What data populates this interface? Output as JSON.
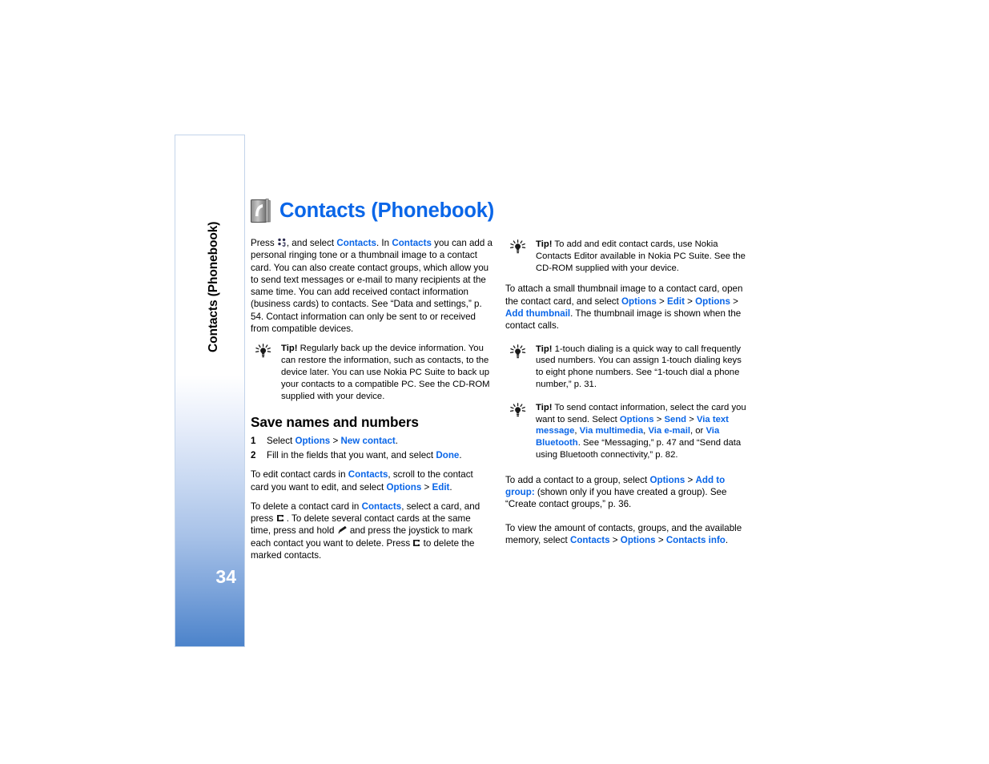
{
  "sidebar": {
    "tab_label": "Contacts (Phonebook)",
    "page_number": "34",
    "accent": "#4a82ca"
  },
  "header": {
    "icon": "phonebook-icon",
    "title": "Contacts (Phonebook)",
    "title_color": "#0a66e8"
  },
  "left_column": {
    "intro": {
      "t1": "Press ",
      "glyph1": "menu-key-icon",
      "t2": ", and select ",
      "l1": "Contacts",
      "t3": ". In ",
      "l2": "Contacts",
      "t4": " you can add a personal ringing tone or a thumbnail image to a contact card. You can also create contact groups, which allow you to send text messages or e-mail to many recipients at the same time. You can add received contact information (business cards) to contacts. See “Data and settings,” p. 54. Contact information can only be sent to or received from compatible devices."
    },
    "tip1": {
      "label": "Tip!",
      "text": " Regularly back up the device information. You can restore the information, such as contacts, to the device later. You can use Nokia PC Suite to back up your contacts to a compatible PC. See the CD-ROM supplied with your device."
    },
    "section_heading": "Save names and numbers",
    "step1": {
      "num": "1",
      "t1": "Select ",
      "l1": "Options",
      "t2": " > ",
      "l2": "New contact",
      "t3": "."
    },
    "step2": {
      "num": "2",
      "t1": "Fill in the fields that you want, and select ",
      "l1": "Done",
      "t2": "."
    },
    "edit_para": {
      "t1": "To edit contact cards in ",
      "l1": "Contacts",
      "t2": ", scroll to the contact card you want to edit, and select ",
      "l2": "Options",
      "t3": " > ",
      "l3": "Edit",
      "t4": "."
    },
    "delete_para": {
      "t1": "To delete a contact card in ",
      "l1": "Contacts",
      "t2": ", select a card, and press ",
      "glyph1": "clear-key-icon",
      "t3": " . To delete several contact cards at the same time, press and hold ",
      "glyph2": "edit-key-icon",
      "t4": " and press the joystick to mark each contact you want to delete. Press ",
      "glyph3": "clear-key-icon",
      "t5": " to delete the marked contacts."
    }
  },
  "right_column": {
    "tip2": {
      "label": "Tip!",
      "text": " To add and edit contact cards, use Nokia Contacts Editor available in Nokia PC Suite. See the CD-ROM supplied with your device."
    },
    "thumbnail_para": {
      "t1": "To attach a small thumbnail image to a contact card, open the contact card, and select ",
      "l1": "Options",
      "t2": " > ",
      "l2": "Edit",
      "t3": " > ",
      "l3": "Options",
      "t4": " > ",
      "l4": "Add thumbnail",
      "t5": ". The thumbnail image is shown when the contact calls."
    },
    "tip3": {
      "label": "Tip!",
      "text": " 1-touch dialing is a quick way to call frequently used numbers. You can assign 1-touch dialing keys to eight phone numbers. See “1-touch dial a phone number,” p. 31."
    },
    "tip4": {
      "label": "Tip!",
      "t1": " To send contact information, select the card you want to send. Select ",
      "l1": "Options",
      "t2": " > ",
      "l2": "Send",
      "t3": " > ",
      "l3": "Via text message",
      "t4": ", ",
      "l4": "Via multimedia",
      "t5": ", ",
      "l5": "Via e-mail",
      "t6": ", or ",
      "l6": "Via Bluetooth",
      "t7": ". See “Messaging,” p. 47 and “Send data using Bluetooth connectivity,” p. 82."
    },
    "group_para": {
      "t1": "To add a contact to a group, select ",
      "l1": "Options",
      "t2": " > ",
      "l2": "Add to group:",
      "t3": " (shown only if you have created a group). See “Create contact groups,” p. 36."
    },
    "info_para": {
      "t1": "To view the amount of contacts, groups, and the available memory, select ",
      "l1": "Contacts",
      "t2": " > ",
      "l2": "Options",
      "t3": " > ",
      "l3": "Contacts info",
      "t4": "."
    }
  }
}
